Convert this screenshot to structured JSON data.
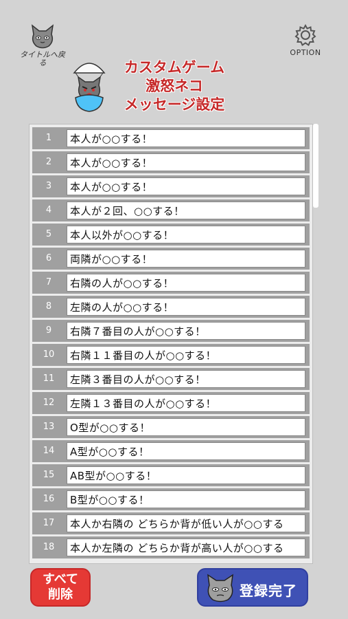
{
  "header": {
    "title_button_label": "タイトルへ戻る",
    "option_label": "OPTION",
    "title_lines": [
      "カスタムゲーム",
      "激怒ネコ",
      "メッセージ設定"
    ]
  },
  "messages": [
    {
      "num": "1",
      "text": "本人が○○する！"
    },
    {
      "num": "2",
      "text": "本人が○○する！"
    },
    {
      "num": "3",
      "text": "本人が○○する！"
    },
    {
      "num": "4",
      "text": "本人が２回、○○する！"
    },
    {
      "num": "5",
      "text": "本人以外が○○する！"
    },
    {
      "num": "6",
      "text": "両隣が○○する！"
    },
    {
      "num": "7",
      "text": "右隣の人が○○する！"
    },
    {
      "num": "8",
      "text": "左隣の人が○○する！"
    },
    {
      "num": "9",
      "text": "右隣７番目の人が○○する！"
    },
    {
      "num": "10",
      "text": "右隣１１番目の人が○○する！"
    },
    {
      "num": "11",
      "text": "左隣３番目の人が○○する！"
    },
    {
      "num": "12",
      "text": "左隣１３番目の人が○○する！"
    },
    {
      "num": "13",
      "text": "O型が○○する！"
    },
    {
      "num": "14",
      "text": "A型が○○する！"
    },
    {
      "num": "15",
      "text": "AB型が○○する！"
    },
    {
      "num": "16",
      "text": "B型が○○する！"
    },
    {
      "num": "17",
      "text": "本人か右隣の どちらか背が低い人が○○する"
    },
    {
      "num": "18",
      "text": "本人か左隣の どちらか背が高い人が○○する"
    }
  ],
  "buttons": {
    "delete_all_line1": "すべて",
    "delete_all_line2": "削除",
    "register_label": "登録完了"
  },
  "colors": {
    "background": "#d3d3d3",
    "title_red": "#c62828",
    "delete_red": "#e53935",
    "register_blue": "#3f51b5",
    "row_gray": "#a0a0a0"
  }
}
